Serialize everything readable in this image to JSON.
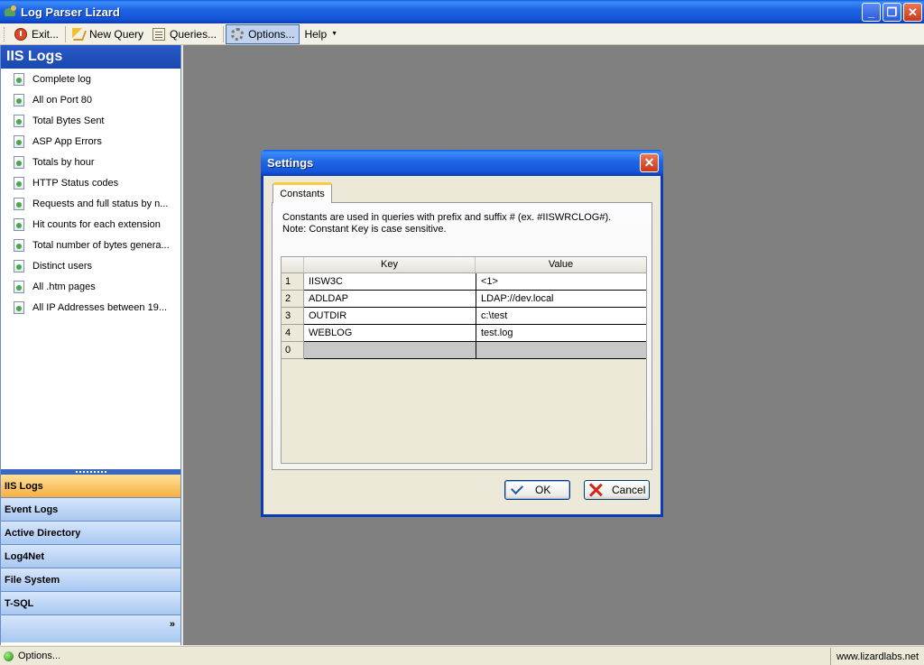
{
  "window": {
    "title": "Log Parser Lizard",
    "minimize": "_",
    "restore": "❐",
    "close": "✕"
  },
  "toolbar": {
    "exit": "Exit...",
    "new_query": "New Query",
    "queries": "Queries...",
    "options": "Options...",
    "help": "Help",
    "help_caret": "▼"
  },
  "left_panel": {
    "header": "IIS Logs",
    "queries": [
      "Complete log",
      "All on Port 80",
      "Total Bytes Sent",
      "ASP App Errors",
      "Totals by hour",
      "HTTP Status codes",
      "Requests and full status by n...",
      "Hit counts for each extension",
      "Total number of bytes genera...",
      "Distinct users",
      "All .htm pages",
      "All IP Addresses between 19..."
    ],
    "nav": [
      "IIS Logs",
      "Event Logs",
      "Active Directory",
      "Log4Net",
      "File System",
      "T-SQL"
    ],
    "active_nav": "IIS Logs",
    "more_glyph": "»"
  },
  "dialog": {
    "title": "Settings",
    "close": "✕",
    "tab": "Constants",
    "desc_line1": "Constants are used in queries with prefix and suffix # (ex. #IISWRCLOG#).",
    "desc_line2": "Note: Constant Key is case sensitive.",
    "grid": {
      "headers": {
        "key": "Key",
        "value": "Value"
      },
      "rows": [
        {
          "num": "1",
          "key": "IISW3C",
          "value": "<1>"
        },
        {
          "num": "2",
          "key": "ADLDAP",
          "value": "LDAP://dev.local"
        },
        {
          "num": "3",
          "key": "OUTDIR",
          "value": "c:\\test"
        },
        {
          "num": "4",
          "key": "WEBLOG",
          "value": "test.log"
        },
        {
          "num": "0",
          "key": "",
          "value": ""
        }
      ]
    },
    "ok": "OK",
    "cancel": "Cancel"
  },
  "statusbar": {
    "left": "Options...",
    "right": "www.lizardlabs.net"
  },
  "colors": {
    "titlebar": "#1f66e6",
    "active_nav": "#f8b040",
    "workspace": "#808080"
  }
}
